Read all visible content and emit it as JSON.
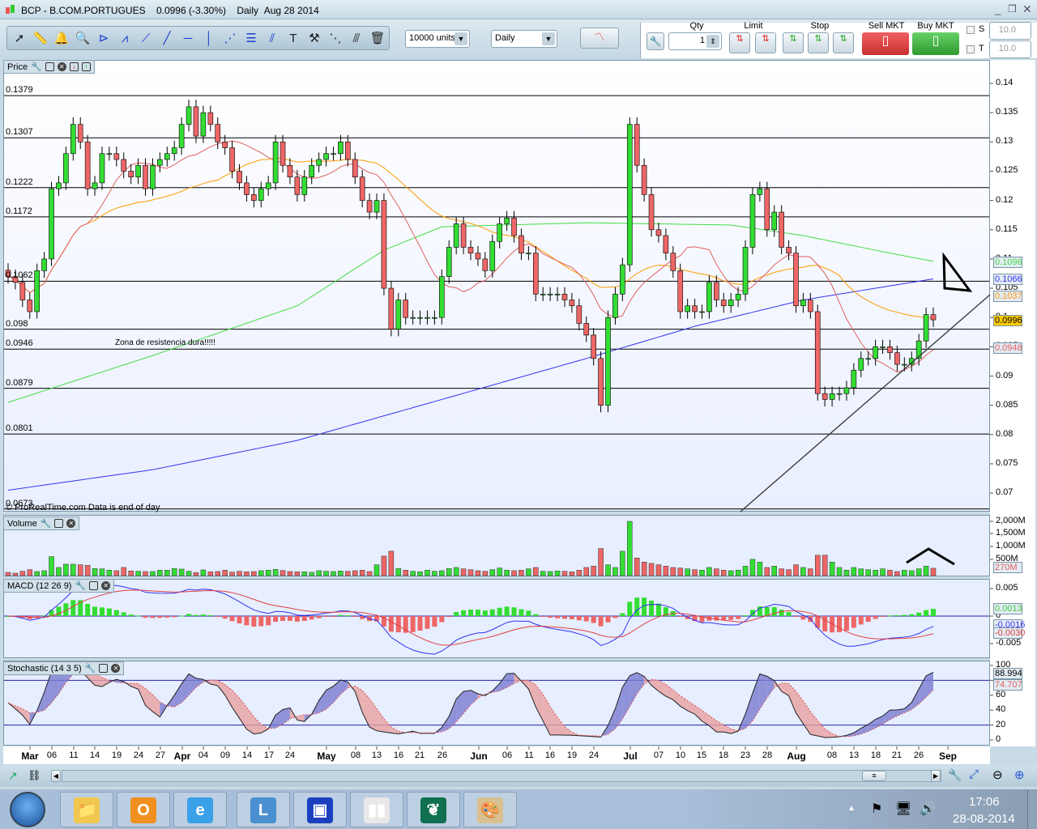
{
  "window": {
    "title": "BCP - B.COM.PORTUGUES",
    "price": "0.0996 (-3.30%)",
    "period": "Daily",
    "date": "Aug 28 2014"
  },
  "toolbar": {
    "units": "10000 units",
    "timeframe": "Daily",
    "qty_label": "Qty",
    "qty_value": "1",
    "limit_label": "Limit",
    "stop_label": "Stop",
    "sell_label": "Sell MKT",
    "buy_label": "Buy MKT",
    "s_label": "S",
    "t_label": "T",
    "s_value": "10.0",
    "t_value": "10.0",
    "tools": [
      "pointer-icon",
      "ruler-icon",
      "alert-bell-icon",
      "zoom-icon",
      "triangle-tool-icon",
      "channel-tool-icon",
      "segment-icon",
      "line-icon",
      "horizontal-line-icon",
      "vertical-line-icon",
      "fibonacci-fan-icon",
      "fibonacci-retracement-icon",
      "parallel-channel-icon",
      "text-tool-icon",
      "tools-icon",
      "point-icon",
      "parallel-line-icon",
      "trash-icon"
    ]
  },
  "panels": {
    "price": "Price",
    "volume": "Volume",
    "macd": "MACD (12 26 9)",
    "stochastic": "Stochastic (14 3 5)"
  },
  "chart_data": {
    "type": "candlestick",
    "symbol": "BCP",
    "closes": [
      0.107,
      0.106,
      0.103,
      0.101,
      0.108,
      0.11,
      0.122,
      0.123,
      0.128,
      0.133,
      0.13,
      0.122,
      0.123,
      0.128,
      0.128,
      0.127,
      0.125,
      0.124,
      0.126,
      0.122,
      0.126,
      0.127,
      0.128,
      0.129,
      0.133,
      0.136,
      0.131,
      0.135,
      0.133,
      0.13,
      0.129,
      0.125,
      0.123,
      0.121,
      0.12,
      0.122,
      0.123,
      0.13,
      0.126,
      0.124,
      0.121,
      0.124,
      0.126,
      0.127,
      0.128,
      0.128,
      0.13,
      0.127,
      0.124,
      0.12,
      0.118,
      0.12,
      0.105,
      0.098,
      0.103,
      0.1,
      0.1,
      0.1,
      0.1,
      0.1,
      0.107,
      0.112,
      0.116,
      0.112,
      0.111,
      0.11,
      0.108,
      0.113,
      0.116,
      0.117,
      0.114,
      0.111,
      0.111,
      0.104,
      0.104,
      0.104,
      0.104,
      0.103,
      0.102,
      0.099,
      0.097,
      0.093,
      0.085,
      0.1,
      0.104,
      0.109,
      0.133,
      0.126,
      0.121,
      0.115,
      0.114,
      0.111,
      0.108,
      0.101,
      0.102,
      0.101,
      0.101,
      0.106,
      0.103,
      0.102,
      0.103,
      0.104,
      0.112,
      0.121,
      0.122,
      0.115,
      0.118,
      0.112,
      0.111,
      0.102,
      0.103,
      0.101,
      0.087,
      0.086,
      0.087,
      0.087,
      0.088,
      0.091,
      0.093,
      0.093,
      0.095,
      0.095,
      0.094,
      0.092,
      0.092,
      0.093,
      0.096,
      0.1005,
      0.0996
    ],
    "volumes_millions": [
      120,
      90,
      160,
      220,
      150,
      180,
      700,
      300,
      420,
      420,
      400,
      380,
      260,
      250,
      200,
      180,
      300,
      170,
      160,
      150,
      150,
      200,
      200,
      260,
      240,
      160,
      110,
      210,
      140,
      150,
      200,
      130,
      160,
      140,
      150,
      180,
      200,
      230,
      190,
      150,
      140,
      140,
      120,
      180,
      160,
      150,
      170,
      160,
      180,
      200,
      150,
      400,
      720,
      900,
      260,
      200,
      160,
      140,
      200,
      160,
      180,
      260,
      300,
      250,
      220,
      180,
      160,
      220,
      280,
      200,
      180,
      200,
      250,
      300,
      160,
      150,
      170,
      160,
      140,
      200,
      300,
      350,
      1000,
      400,
      300,
      900,
      2000,
      650,
      500,
      450,
      400,
      350,
      300,
      280,
      250,
      220,
      200,
      300,
      250,
      200,
      180,
      200,
      350,
      600,
      500,
      300,
      350,
      250,
      220,
      400,
      300,
      250,
      750,
      750,
      500,
      300,
      200,
      300,
      250,
      220,
      200,
      250,
      200,
      150,
      200,
      180,
      250,
      350,
      270
    ],
    "ma_green": [
      [
        0,
        0.0855
      ],
      [
        20,
        0.0935
      ],
      [
        40,
        0.102
      ],
      [
        52,
        0.1115
      ],
      [
        60,
        0.1155
      ],
      [
        80,
        0.1162
      ],
      [
        100,
        0.1158
      ],
      [
        110,
        0.114
      ],
      [
        122,
        0.111
      ],
      [
        128,
        0.1096
      ]
    ],
    "ma_blue": [
      [
        0,
        0.0705
      ],
      [
        20,
        0.074
      ],
      [
        40,
        0.079
      ],
      [
        60,
        0.086
      ],
      [
        80,
        0.093
      ],
      [
        95,
        0.0985
      ],
      [
        110,
        0.103
      ],
      [
        128,
        0.1066
      ]
    ],
    "y_ticks": [
      "0.14",
      "0.135",
      "0.13",
      "0.125",
      "0.12",
      "0.115",
      "0.11",
      "0.105",
      "0.1",
      "0.095",
      "0.09",
      "0.085",
      "0.08",
      "0.075",
      "0.07"
    ],
    "levels": [
      "0.1379",
      "0.1307",
      "0.1222",
      "0.1172",
      "0.1062",
      "0.098",
      "0.0946",
      "0.0879",
      "0.0801",
      "0.0673"
    ],
    "annotation": "Zona de resistencia dura!!!!!",
    "last_values": {
      "ma100": "0.1096",
      "ma200": "0.1066",
      "ma50": "0.1037",
      "close": "0.0996",
      "ma20": "0.0948"
    },
    "volume_ticks": [
      "2,000M",
      "1,500M",
      "1,000M",
      "500M"
    ],
    "volume_last": "270M",
    "macd_ticks": [
      "0.005",
      "0",
      "-0.005"
    ],
    "macd_last": {
      "hist": "0.0013",
      "macd": "-0.0016",
      "signal": "-0.0030"
    },
    "stoch_ticks": [
      "100",
      "80",
      "60",
      "40",
      "20",
      "0"
    ],
    "stoch_last": {
      "k": "88.994",
      "d": "74.707"
    },
    "x_labels": [
      {
        "t": "Mar",
        "b": 1
      },
      {
        "t": "06"
      },
      {
        "t": "11"
      },
      {
        "t": "14"
      },
      {
        "t": "19"
      },
      {
        "t": "24"
      },
      {
        "t": "27"
      },
      {
        "t": "Apr",
        "b": 1
      },
      {
        "t": "04"
      },
      {
        "t": "09"
      },
      {
        "t": "14"
      },
      {
        "t": "17"
      },
      {
        "t": "24"
      },
      {
        "t": "May",
        "b": 1
      },
      {
        "t": "08"
      },
      {
        "t": "13"
      },
      {
        "t": "16"
      },
      {
        "t": "21"
      },
      {
        "t": "26"
      },
      {
        "t": "Jun",
        "b": 1
      },
      {
        "t": "06"
      },
      {
        "t": "11"
      },
      {
        "t": "16"
      },
      {
        "t": "19"
      },
      {
        "t": "24"
      },
      {
        "t": "Jul",
        "b": 1
      },
      {
        "t": "07"
      },
      {
        "t": "10"
      },
      {
        "t": "15"
      },
      {
        "t": "18"
      },
      {
        "t": "23"
      },
      {
        "t": "28"
      },
      {
        "t": "Aug",
        "b": 1
      },
      {
        "t": "08"
      },
      {
        "t": "13"
      },
      {
        "t": "18"
      },
      {
        "t": "21"
      },
      {
        "t": "26"
      },
      {
        "t": "Sep",
        "b": 1
      }
    ],
    "watermark": "© ProRealTime.com  Data is end of day",
    "colors": {
      "up": "#33dd33",
      "down": "#ee6666",
      "ma20": "#e06060",
      "ma50": "#ff9900",
      "ma100": "#44dd44",
      "ma200": "#3333ee"
    }
  },
  "taskbar": {
    "time": "17:06",
    "date": "28-08-2014",
    "apps": [
      "file-explorer-icon",
      "outlook-icon",
      "internet-explorer-icon",
      "lync-icon",
      "remote-desktop-icon",
      "prorealtime-icon",
      "app-leaf-icon",
      "paint-icon"
    ]
  }
}
